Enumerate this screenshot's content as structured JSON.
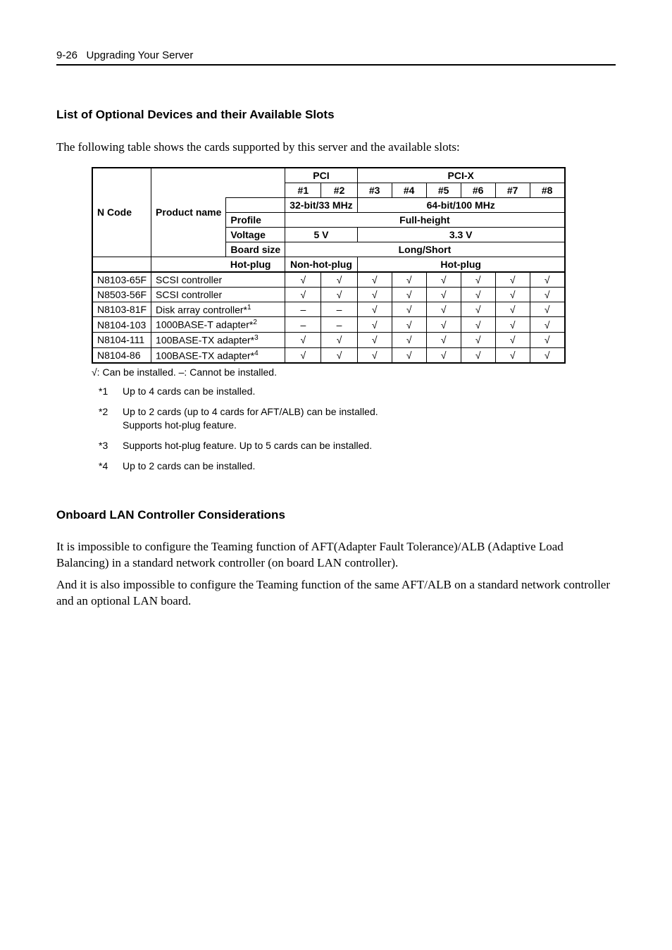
{
  "header": {
    "page_num": "9-26",
    "title": "Upgrading Your Server"
  },
  "s1": {
    "heading": "List of Optional Devices and their Available Slots",
    "intro": "The following table shows the cards supported by this server and the available slots:"
  },
  "table": {
    "hdr": {
      "ncode": "N Code",
      "pname": "Product name",
      "pci": "PCI",
      "pcix": "PCI-X",
      "s1": "#1",
      "s2": "#2",
      "s3": "#3",
      "s4": "#4",
      "s5": "#5",
      "s6": "#6",
      "s7": "#7",
      "s8": "#8",
      "bus12": "32-bit/33 MHz",
      "bus38": "64-bit/100 MHz",
      "profile_lbl": "Profile",
      "profile_val": "Full-height",
      "voltage_lbl": "Voltage",
      "voltage12": "5 V",
      "voltage38": "3.3 V",
      "board_lbl": "Board size",
      "board_val": "Long/Short",
      "hot_lbl": "Hot-plug",
      "hot12": "Non-hot-plug",
      "hot38": "Hot-plug"
    },
    "rows": [
      {
        "code": "N8103-65F",
        "name": "SCSI controller",
        "sup": "",
        "v": [
          "√",
          "√",
          "√",
          "√",
          "√",
          "√",
          "√",
          "√"
        ]
      },
      {
        "code": "N8503-56F",
        "name": "SCSI controller",
        "sup": "",
        "v": [
          "√",
          "√",
          "√",
          "√",
          "√",
          "√",
          "√",
          "√"
        ]
      },
      {
        "code": "N8103-81F",
        "name": "Disk array controller*",
        "sup": "1",
        "v": [
          "–",
          "–",
          "√",
          "√",
          "√",
          "√",
          "√",
          "√"
        ]
      },
      {
        "code": "N8104-103",
        "name": "1000BASE-T adapter*",
        "sup": "2",
        "v": [
          "–",
          "–",
          "√",
          "√",
          "√",
          "√",
          "√",
          "√"
        ]
      },
      {
        "code": "N8104-111",
        "name": "100BASE-TX adapter*",
        "sup": "3",
        "v": [
          "√",
          "√",
          "√",
          "√",
          "√",
          "√",
          "√",
          "√"
        ]
      },
      {
        "code": "N8104-86",
        "name": "100BASE-TX adapter*",
        "sup": "4",
        "v": [
          "√",
          "√",
          "√",
          "√",
          "√",
          "√",
          "√",
          "√"
        ]
      }
    ]
  },
  "legend": "√: Can be installed. –: Cannot be installed.",
  "notes": [
    {
      "marker": "*1",
      "text": "Up to 4 cards can be installed."
    },
    {
      "marker": "*2",
      "text": "Up to 2 cards (up to 4 cards for AFT/ALB) can be installed.\nSupports hot-plug feature."
    },
    {
      "marker": "*3",
      "text": "Supports hot-plug feature. Up to 5 cards can be installed."
    },
    {
      "marker": "*4",
      "text": "Up to 2 cards can be installed."
    }
  ],
  "s2": {
    "heading": "Onboard LAN Controller Considerations",
    "p1": "It is impossible to configure the Teaming function of AFT(Adapter Fault Tolerance)/ALB (Adaptive Load Balancing) in a standard network controller (on board LAN controller).",
    "p2": "And it is also impossible to configure the Teaming function of the same AFT/ALB on a standard network controller and an optional LAN board."
  }
}
